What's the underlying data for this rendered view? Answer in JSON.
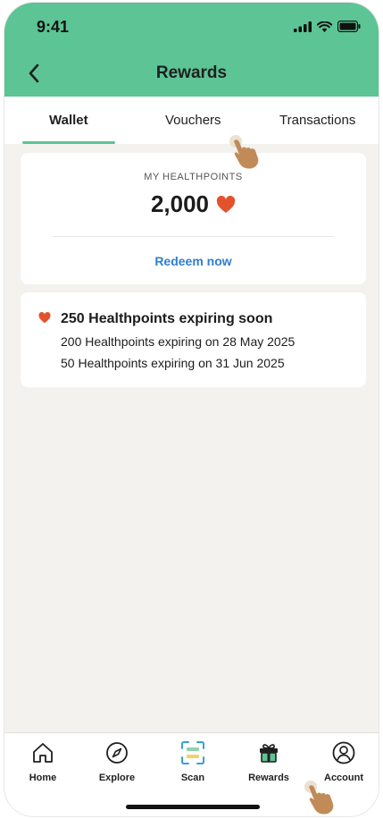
{
  "status_bar": {
    "time": "9:41"
  },
  "header": {
    "title": "Rewards"
  },
  "tabs": [
    {
      "label": "Wallet",
      "active": true
    },
    {
      "label": "Vouchers",
      "active": false
    },
    {
      "label": "Transactions",
      "active": false
    }
  ],
  "points_card": {
    "label": "MY HEALTHPOINTS",
    "value": "2,000",
    "redeem_label": "Redeem now"
  },
  "expiry_card": {
    "title": "250 Healthpoints expiring soon",
    "lines": [
      "200 Healthpoints expiring on 28 May 2025",
      "50 Healthpoints expiring on 31 Jun 2025"
    ]
  },
  "bottom_nav": [
    {
      "label": "Home",
      "icon": "home-icon"
    },
    {
      "label": "Explore",
      "icon": "compass-icon"
    },
    {
      "label": "Scan",
      "icon": "scan-icon"
    },
    {
      "label": "Rewards",
      "icon": "gift-icon"
    },
    {
      "label": "Account",
      "icon": "user-icon"
    }
  ],
  "colors": {
    "brand_green": "#5cc495",
    "heart_red": "#e2522d",
    "link_blue": "#2f7fcf",
    "background": "#f3f2ef"
  }
}
